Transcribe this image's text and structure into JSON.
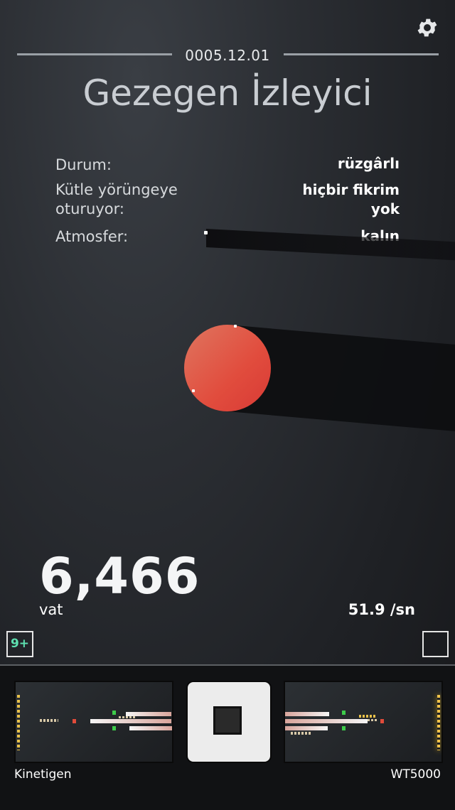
{
  "header": {
    "date": "0005.12.01",
    "title": "Gezegen İzleyici"
  },
  "stats": [
    {
      "label": "Durum:",
      "value": "rüzgârlı"
    },
    {
      "label": "Kütle yörüngeye oturuyor:",
      "value": "hiçbir fikrim yok"
    },
    {
      "label": "Atmosfer:",
      "value": "kalın"
    }
  ],
  "planet": {
    "color": "#e1513f"
  },
  "energy": {
    "value": "6,466",
    "unit": "vat",
    "rate": "51.9 /sn"
  },
  "badge": {
    "label": "9+"
  },
  "machines": {
    "left_label": "Kinetigen",
    "right_label": "WT5000"
  },
  "colors": {
    "accent": "#5ee0b0",
    "planet": "#e1513f",
    "bar_yellow": "#e8c14a",
    "bar_green": "#3dcb4a",
    "bar_red": "#e04b3a"
  }
}
